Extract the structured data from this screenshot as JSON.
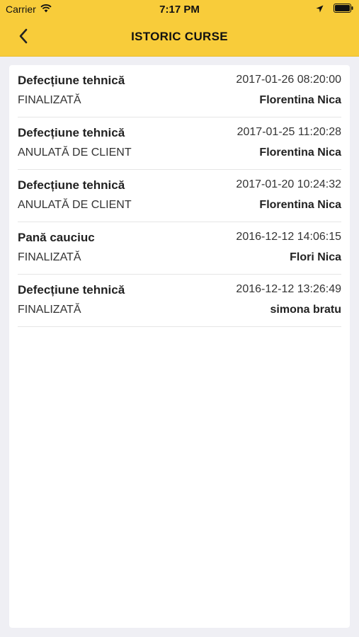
{
  "status_bar": {
    "carrier": "Carrier",
    "time": "7:17 PM",
    "icons": [
      "wifi-icon",
      "location-arrow-icon",
      "battery-icon"
    ]
  },
  "header": {
    "title": "ISTORIC CURSE",
    "back_icon": "chevron-left-icon",
    "background_color": "#f8cc3a"
  },
  "rides": [
    {
      "title": "Defecțiune tehnică",
      "datetime": "2017-01-26 08:20:00",
      "status": "FINALIZATĂ",
      "driver": "Florentina Nica"
    },
    {
      "title": "Defecțiune tehnică",
      "datetime": "2017-01-25 11:20:28",
      "status": "ANULATĂ DE CLIENT",
      "driver": "Florentina Nica"
    },
    {
      "title": "Defecțiune tehnică",
      "datetime": "2017-01-20 10:24:32",
      "status": "ANULATĂ DE CLIENT",
      "driver": "Florentina Nica"
    },
    {
      "title": "Pană cauciuc",
      "datetime": "2016-12-12 14:06:15",
      "status": "FINALIZATĂ",
      "driver": "Flori Nica"
    },
    {
      "title": "Defecțiune tehnică",
      "datetime": "2016-12-12 13:26:49",
      "status": "FINALIZATĂ",
      "driver": "simona bratu"
    }
  ]
}
